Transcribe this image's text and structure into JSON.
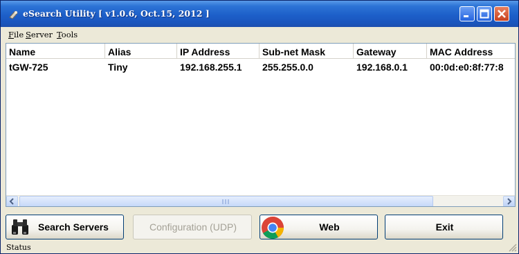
{
  "window": {
    "title": "eSearch Utility [ v1.0.6, Oct.15, 2012 ]",
    "icon": "binoculars-icon"
  },
  "menu": [
    "File",
    "Server",
    "Tools"
  ],
  "table": {
    "columns": [
      "Name",
      "Alias",
      "IP Address",
      "Sub-net Mask",
      "Gateway",
      "MAC Address"
    ],
    "rows": [
      [
        "tGW-725",
        "Tiny",
        "192.168.255.1",
        "255.255.0.0",
        "192.168.0.1",
        "00:0d:e0:8f:77:8"
      ]
    ]
  },
  "buttons": {
    "search_servers": "Search Servers",
    "configuration": "Configuration (UDP)",
    "web": "Web",
    "exit": "Exit"
  },
  "status": "Status",
  "colors": {
    "titlebar": "#1d5fc9",
    "window_bg": "#ece9d8",
    "close_button": "#c8411e"
  }
}
